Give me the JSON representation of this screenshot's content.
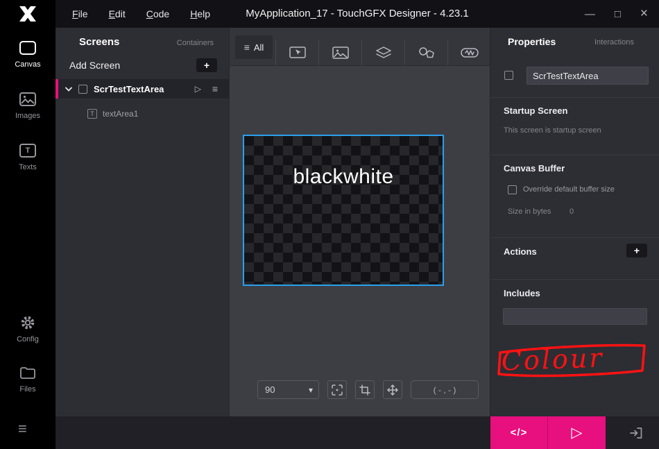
{
  "titlebar": {
    "menus": [
      "File",
      "Edit",
      "Code",
      "Help"
    ],
    "title": "MyApplication_17 - TouchGFX Designer - 4.23.1"
  },
  "icons": {
    "minimize": "—",
    "maximize": "□",
    "close": "×",
    "hamburger": "≡",
    "plus": "+",
    "chevron_down": "▾",
    "play": "▷",
    "code_glyph": "</>",
    "filter": "≡",
    "text_glyph": "T"
  },
  "sidebar": {
    "items": [
      {
        "label": "Canvas",
        "active": true
      },
      {
        "label": "Images",
        "active": false
      },
      {
        "label": "Texts",
        "active": false
      },
      {
        "label": "Config",
        "active": false
      },
      {
        "label": "Files",
        "active": false
      }
    ]
  },
  "screens_panel": {
    "tab_screens": "Screens",
    "tab_containers": "Containers",
    "add_screen_label": "Add Screen",
    "screen_name": "ScrTestTextArea",
    "child_name": "textArea1"
  },
  "canvas": {
    "filter_all_label": "All",
    "artboard_text": "blackwhite",
    "zoom_value": "90",
    "coordinates": "( - , - )"
  },
  "properties_panel": {
    "tab_properties": "Properties",
    "tab_interactions": "Interactions",
    "name_value": "ScrTestTextArea",
    "startup_title": "Startup Screen",
    "startup_note": "This screen is startup screen",
    "buffer_title": "Canvas Buffer",
    "buffer_override_label": "Override default buffer size",
    "buffer_size_label": "Size in bytes",
    "buffer_size_value": "0",
    "actions_title": "Actions",
    "includes_title": "Includes",
    "annotation_text": "Colour"
  },
  "colors": {
    "accent_pink": "#e80f7e",
    "selection_blue": "#2aa0ee",
    "annotation_red": "#ff1212"
  }
}
